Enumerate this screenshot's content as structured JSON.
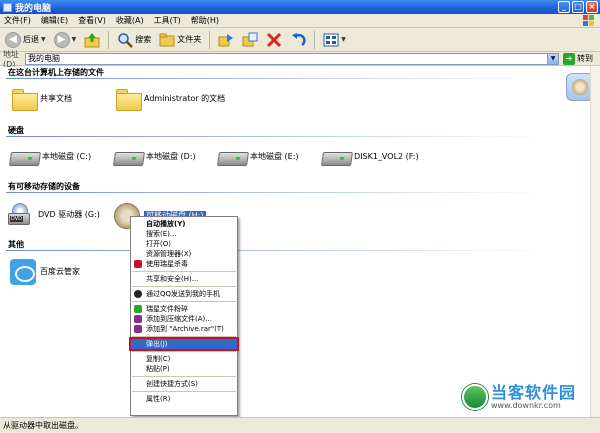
{
  "window": {
    "title": "我的电脑"
  },
  "menu": [
    "文件(F)",
    "编辑(E)",
    "查看(V)",
    "收藏(A)",
    "工具(T)",
    "帮助(H)"
  ],
  "toolbar": {
    "back": "后退",
    "search": "搜索",
    "folders": "文件夹"
  },
  "address": {
    "label": "地址(D)",
    "value": "我的电脑",
    "go": "转到"
  },
  "groups": {
    "stored": "在这台计算机上存储的文件",
    "hdd": "硬盘",
    "removable": "有可移动存储的设备",
    "other": "其他"
  },
  "stored_items": [
    "共享文档",
    "Administrator 的文档"
  ],
  "hdd_items": [
    "本地磁盘 (C:)",
    "本地磁盘 (D:)",
    "本地磁盘 (E:)",
    "DISK1_VOL2 (F:)"
  ],
  "removable_items": [
    "DVD 驱动器 (G:)",
    "可移动磁盘 (H:)"
  ],
  "other_items": [
    "百度云管家"
  ],
  "context_menu": [
    "自动播放(Y)",
    "搜索(E)...",
    "打开(O)",
    "资源管理器(X)",
    "使用瑞星杀毒",
    "共享和安全(H)...",
    "通过QQ发送到我的手机",
    "瑞星文件粉碎",
    "添加到压缩文件(A)...",
    "添加到 \"Archive.rar\"(T)",
    "弹出(J)",
    "复制(C)",
    "粘贴(P)",
    "创建快捷方式(S)",
    "属性(R)"
  ],
  "status": "从驱动器中取出磁盘。",
  "watermark": {
    "name": "当客软件园",
    "url": "www.downkr.com"
  },
  "colors": {
    "titlebar": "#1f5fd6",
    "highlight": "#316ac5",
    "highlight_outline": "#c8102e"
  }
}
